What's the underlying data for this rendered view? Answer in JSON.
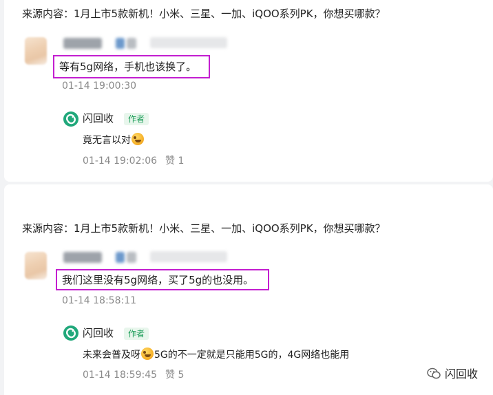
{
  "comments": [
    {
      "source": "来源内容：1月上市5款新机！小米、三星、一加、iQOO系列PK，你想买哪款？",
      "text": "等有5g网络，手机也该换了。",
      "time": "01-14 19:00:30",
      "reply": {
        "author": "闪回收",
        "tag": "作者",
        "text_before": "竟无言以对",
        "text_after": "",
        "time": "01-14 19:02:06",
        "likes": "赞 1"
      }
    },
    {
      "source": "来源内容：1月上市5款新机！小米、三星、一加、iQOO系列PK，你想买哪款？",
      "text": "我们这里没有5g网络，买了5g的也没用。",
      "time": "01-14 18:58:11",
      "reply": {
        "author": "闪回收",
        "tag": "作者",
        "text_before": "未来会普及呀",
        "text_after": "5G的不一定就是只能用5G的，4G网络也能用",
        "time": "01-14 18:59:45",
        "likes": "赞 5"
      }
    }
  ],
  "watermark": "闪回收",
  "colors": {
    "highlight": "#c31ed0",
    "author_tag": "#1e9e5a",
    "logo": "#21a87b"
  },
  "icons": {
    "reply_emoji": "facepalm-emoji-icon",
    "logo": "shanhuishou-logo-icon",
    "watermark": "wechat-icon"
  }
}
